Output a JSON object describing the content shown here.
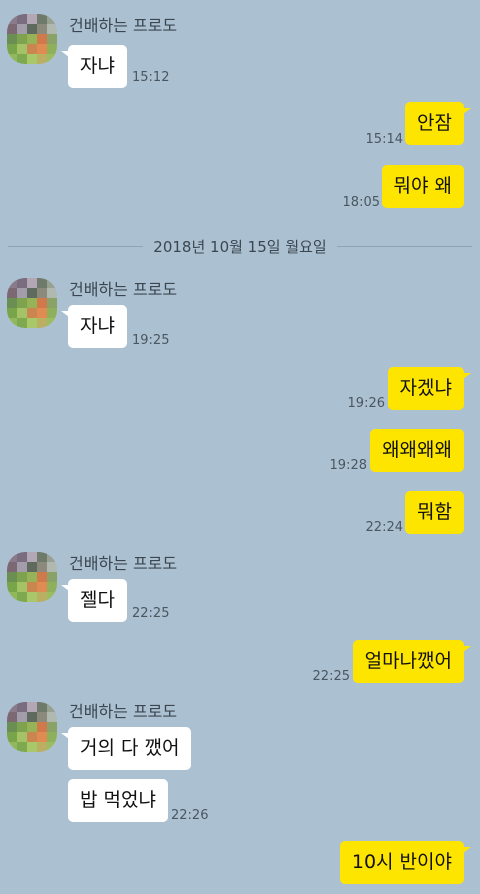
{
  "sender_name": "건배하는 프로도",
  "date_divider": "2018년 10월 15일 월요일",
  "avatar_colors": [
    "#8a7a8a",
    "#7a6d80",
    "#b3a7b5",
    "#6f7b6a",
    "#98a093",
    "#7c6872",
    "#a39cab",
    "#5d6a5d",
    "#8c8a7d",
    "#b0b8b0",
    "#6b8f52",
    "#7fa24f",
    "#96b35a",
    "#d07a4c",
    "#8aa267",
    "#78a44a",
    "#a4c266",
    "#c9864f",
    "#e08b52",
    "#8eb05b",
    "#93b75c",
    "#7ea94f",
    "#a8c86a",
    "#b9b063",
    "#9bbd60"
  ],
  "colors": {
    "background": "#abc1d1",
    "outgoing_bubble": "#fee500",
    "incoming_bubble": "#ffffff"
  },
  "messages": [
    {
      "dir": "in",
      "text": "자냐",
      "time": "15:12"
    },
    {
      "dir": "out",
      "text": "안잠",
      "time": "15:14"
    },
    {
      "dir": "out",
      "text": "뭐야 왜",
      "time": "18:05"
    },
    {
      "dir": "in",
      "text": "자냐",
      "time": "19:25"
    },
    {
      "dir": "out",
      "text": "자겠냐",
      "time": "19:26"
    },
    {
      "dir": "out",
      "text": "왜왜왜왜",
      "time": "19:28"
    },
    {
      "dir": "out",
      "text": "뭐함",
      "time": "22:24"
    },
    {
      "dir": "in",
      "text": "젤다",
      "time": "22:25"
    },
    {
      "dir": "out",
      "text": "얼마나깼어",
      "time": "22:25"
    },
    {
      "dir": "in",
      "text": "거의 다 깼어",
      "time": ""
    },
    {
      "dir": "in",
      "text": "밥 먹었냐",
      "time": "22:26"
    },
    {
      "dir": "out",
      "text": "10시 반이야",
      "time": ""
    }
  ]
}
